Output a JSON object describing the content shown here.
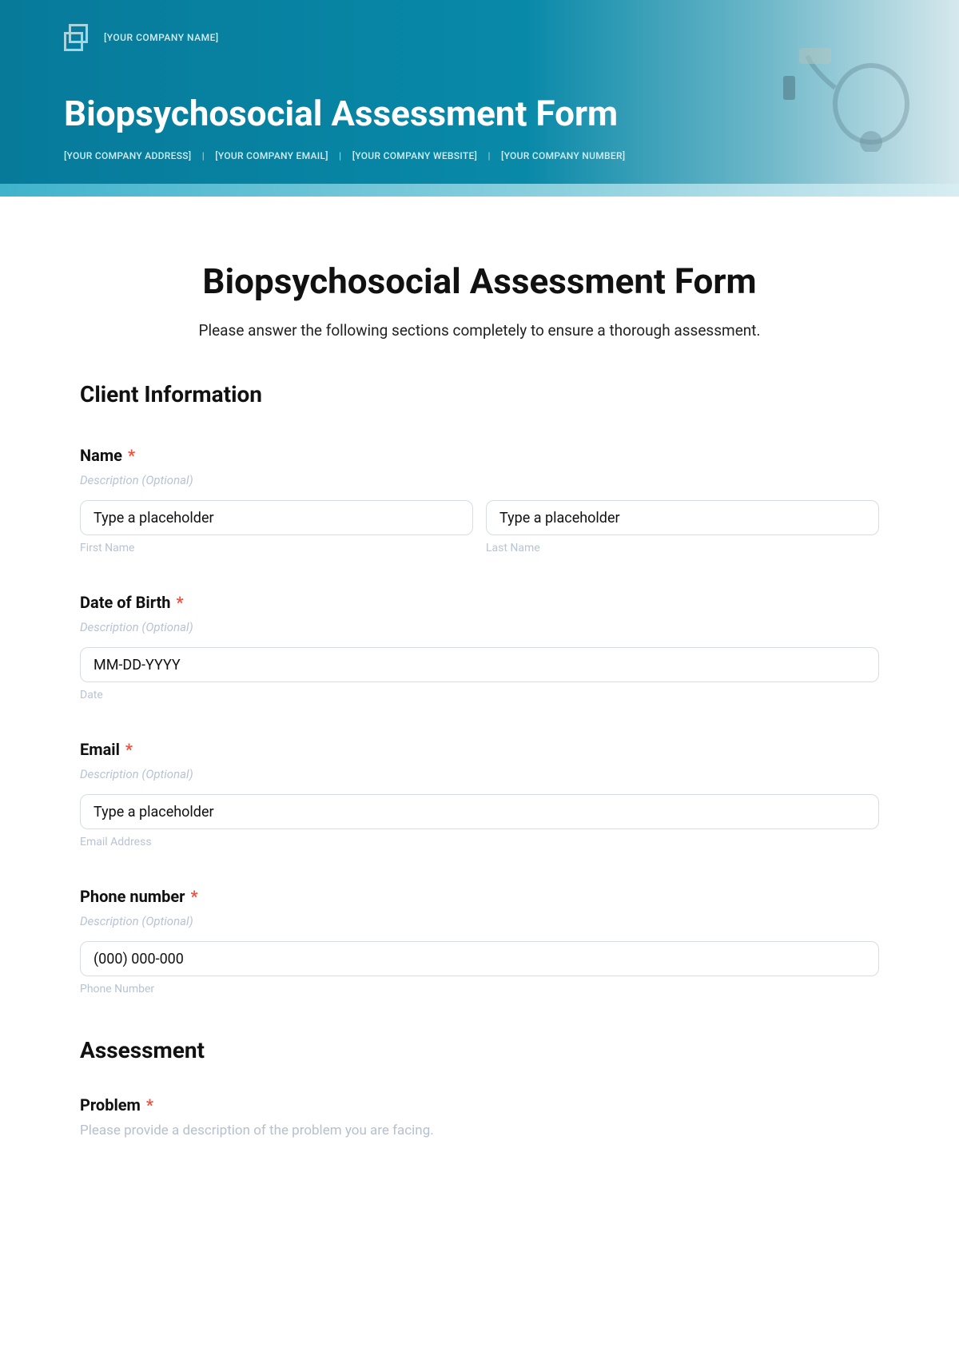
{
  "header": {
    "company_name": "[YOUR COMPANY NAME]",
    "title": "Biopsychosocial Assessment Form",
    "meta": {
      "address": "[YOUR COMPANY ADDRESS]",
      "email": "[YOUR COMPANY EMAIL]",
      "website": "[YOUR COMPANY WEBSITE]",
      "number": "[YOUR COMPANY NUMBER]"
    }
  },
  "main": {
    "title": "Biopsychosocial Assessment Form",
    "subtitle": "Please answer the following sections completely to ensure a thorough assessment."
  },
  "sections": {
    "client_info_heading": "Client Information",
    "assessment_heading": "Assessment"
  },
  "fields": {
    "name": {
      "label": "Name",
      "desc": "Description (Optional)",
      "first_placeholder": "Type a placeholder",
      "first_sublabel": "First Name",
      "last_placeholder": "Type a placeholder",
      "last_sublabel": "Last Name"
    },
    "dob": {
      "label": "Date of Birth",
      "desc": "Description (Optional)",
      "placeholder": "MM-DD-YYYY",
      "sublabel": "Date"
    },
    "email": {
      "label": "Email",
      "desc": "Description (Optional)",
      "placeholder": "Type a placeholder",
      "sublabel": "Email Address"
    },
    "phone": {
      "label": "Phone number",
      "desc": "Description (Optional)",
      "placeholder": "(000) 000-000",
      "sublabel": "Phone Number"
    },
    "problem": {
      "label": "Problem",
      "desc": "Please provide a description of the problem you are facing."
    }
  },
  "required_mark": "*"
}
